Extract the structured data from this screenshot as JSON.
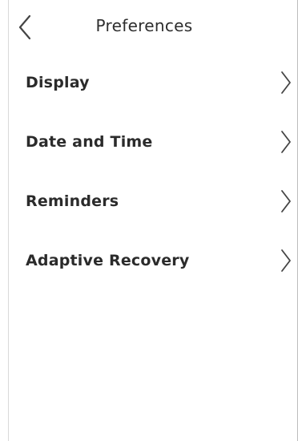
{
  "header": {
    "title": "Preferences",
    "back_icon": "chevron-left-icon"
  },
  "menu": {
    "items": [
      {
        "label": "Display",
        "icon": "chevron-right-icon"
      },
      {
        "label": "Date and Time",
        "icon": "chevron-right-icon"
      },
      {
        "label": "Reminders",
        "icon": "chevron-right-icon"
      },
      {
        "label": "Adaptive Recovery",
        "icon": "chevron-right-icon"
      }
    ]
  },
  "colors": {
    "background": "#ffffff",
    "text": "#2b2b2b",
    "icon_stroke": "#444444"
  }
}
